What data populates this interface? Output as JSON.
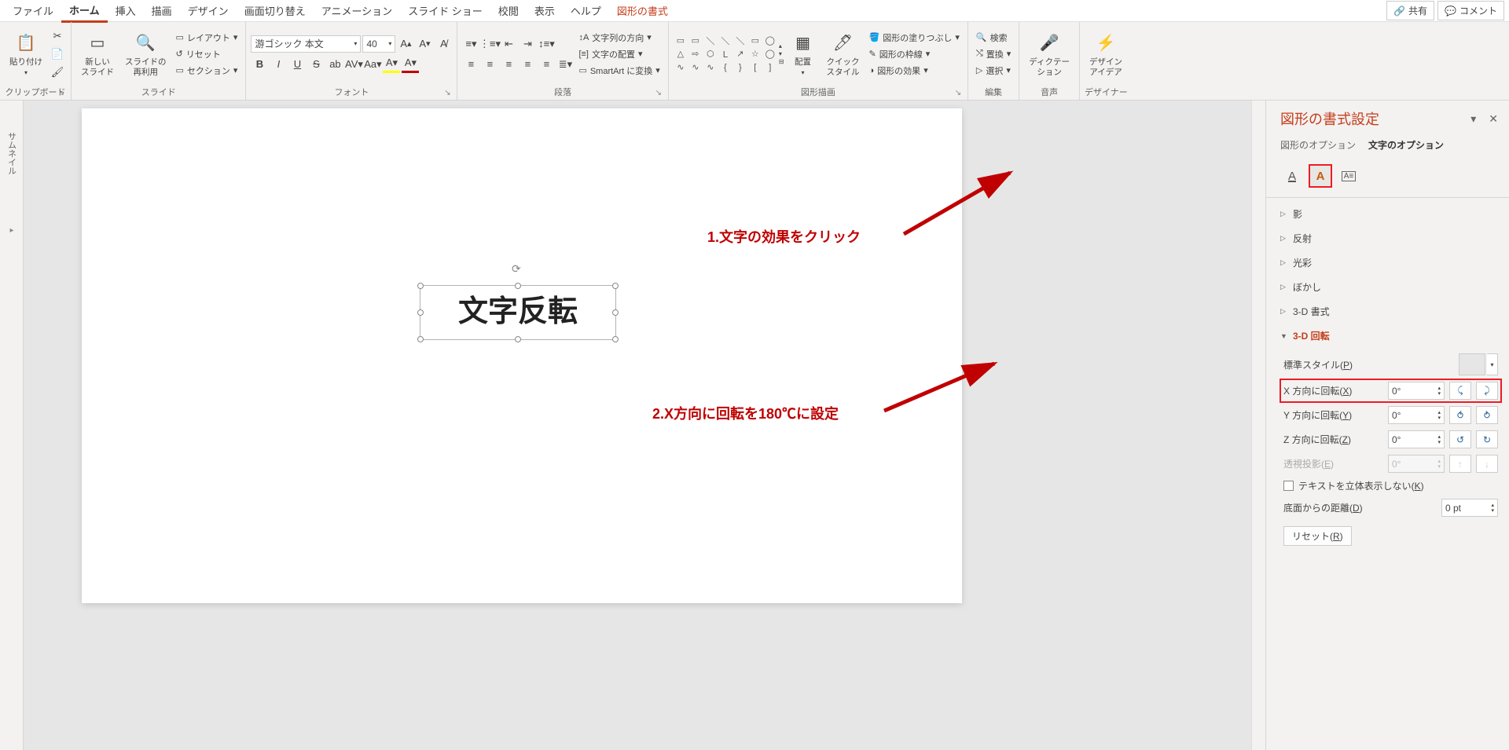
{
  "tabs": {
    "file": "ファイル",
    "home": "ホーム",
    "insert": "挿入",
    "draw": "描画",
    "design": "デザイン",
    "transition": "画面切り替え",
    "animation": "アニメーション",
    "slideshow": "スライド ショー",
    "review": "校閲",
    "view": "表示",
    "help": "ヘルプ",
    "shapeformat": "図形の書式",
    "share": "共有",
    "comment": "コメント"
  },
  "ribbon": {
    "clipboard": {
      "paste": "貼り付け",
      "label": "クリップボード"
    },
    "slides": {
      "new": "新しい\nスライド",
      "reuse": "スライドの\n再利用",
      "layout": "レイアウト",
      "reset": "リセット",
      "section": "セクション",
      "label": "スライド"
    },
    "font": {
      "name": "游ゴシック 本文",
      "size": "40",
      "label": "フォント"
    },
    "para": {
      "textdir": "文字列の方向",
      "align": "文字の配置",
      "smartart": "SmartArt に変換",
      "label": "段落"
    },
    "shapes": {
      "arrange": "配置",
      "quick": "クイック\nスタイル",
      "fill": "図形の塗りつぶし",
      "outline": "図形の枠線",
      "effects": "図形の効果",
      "label": "図形描画"
    },
    "edit": {
      "find": "検索",
      "replace": "置換",
      "select": "選択",
      "label": "編集"
    },
    "voice": {
      "dictate": "ディクテー\nション",
      "label": "音声"
    },
    "designer": {
      "ideas": "デザイン\nアイデア",
      "label": "デザイナー"
    }
  },
  "thumbnail": "サムネイル",
  "textbox_content": "文字反転",
  "annotations": {
    "a1": "1.文字の効果をクリック",
    "a2": "2.X方向に回転を180℃に設定"
  },
  "panel": {
    "title": "図形の書式設定",
    "tab_shape": "図形のオプション",
    "tab_text": "文字のオプション",
    "acc": {
      "shadow": "影",
      "reflect": "反射",
      "glow": "光彩",
      "soft": "ぼかし",
      "fmt3d": "3-D 書式",
      "rot3d": "3-D 回転"
    },
    "preset": "標準スタイル(",
    "preset_u": "P",
    "preset_end": ")",
    "rotx": "X 方向に回転(",
    "rotx_u": "X",
    "roty": "Y 方向に回転(",
    "roty_u": "Y",
    "rotz": "Z 方向に回転(",
    "rotz_u": "Z",
    "persp": "透視投影(",
    "persp_u": "E",
    "flat": "テキストを立体表示しない(",
    "flat_u": "K",
    "dist": "底面からの距離(",
    "dist_u": "D",
    "reset": "リセット(",
    "reset_u": "R",
    "close_paren": ")",
    "val0": "0°",
    "valpt": "0 pt"
  }
}
